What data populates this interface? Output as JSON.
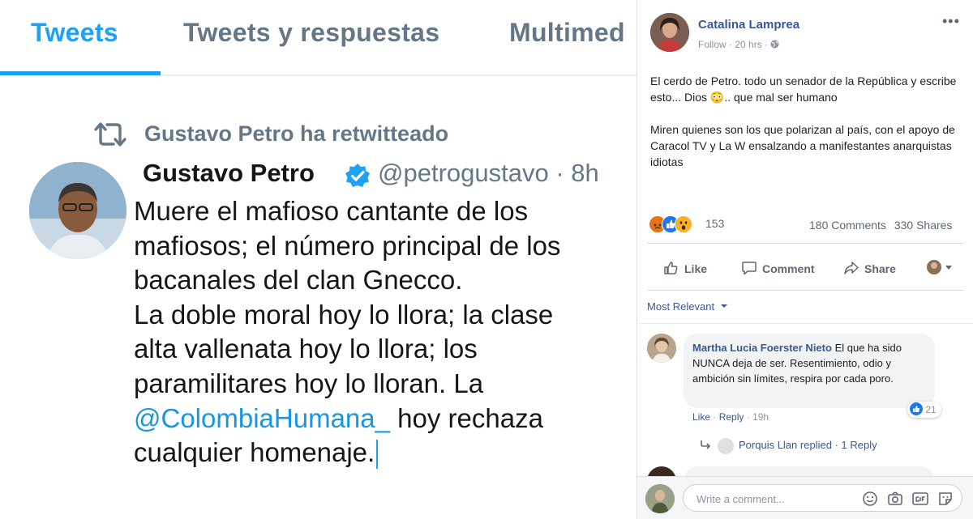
{
  "twitter": {
    "tabs": [
      {
        "label": "Tweets",
        "active": true
      },
      {
        "label": "Tweets y respuestas",
        "active": false
      },
      {
        "label": "Multimed",
        "active": false
      }
    ],
    "retweet_label": "Gustavo Petro ha retwitteado",
    "tweet": {
      "author_name": "Gustavo Petro",
      "handle_time": "@petrogustavo · 8h",
      "lines": [
        "Muere el mafioso cantante de los",
        "mafiosos; el número principal de los",
        "bacanales del clan Gnecco.",
        "La doble moral hoy lo llora; la clase",
        "alta vallenata hoy lo llora; los",
        "paramilitares hoy lo lloran. La"
      ],
      "mention": "@ColombiaHumana_",
      "after_mention": " hoy rechaza",
      "last_line": "cualquier homenaje."
    },
    "colors": {
      "accent": "#1da1f2",
      "muted": "#657786",
      "text": "#14171a"
    }
  },
  "facebook": {
    "post": {
      "author": "Catalina Lamprea",
      "follow": "Follow",
      "time": "20 hrs",
      "paragraph1": "El cerdo de Petro. todo un senador de la República y escribe esto... Dios 😳.. que mal ser humano",
      "paragraph2": "Miren quienes son los que polarizan al país, con el apoyo de Caracol TV y La W ensalzando a manifestantes anarquistas idiotas",
      "more_icon": "more-horizontal-icon"
    },
    "reactions": {
      "icons": [
        "angry",
        "like",
        "wow"
      ],
      "count": "153"
    },
    "counts": {
      "comments": "180 Comments",
      "shares": "330 Shares"
    },
    "actions": {
      "like": "Like",
      "comment": "Comment",
      "share": "Share"
    },
    "sort_label": "Most Relevant",
    "comment": {
      "author": "Martha Lucia Foerster Nieto",
      "text": "El que ha sido NUNCA deja de ser. Resentimiento, odio y ambición sin límites, respira por cada poro.",
      "likes": "21",
      "like": "Like",
      "reply": "Reply",
      "time": "19h",
      "reply_summary": {
        "author": "Porquis Llan",
        "action": "replied",
        "count": "1 Reply"
      }
    },
    "composer": {
      "placeholder": "Write a comment..."
    },
    "colors": {
      "link": "#385898",
      "muted": "#90949c",
      "text": "#1c1e21",
      "like_blue": "#1877f2",
      "angry": "#e9710f",
      "wow": "#f7b125"
    }
  }
}
